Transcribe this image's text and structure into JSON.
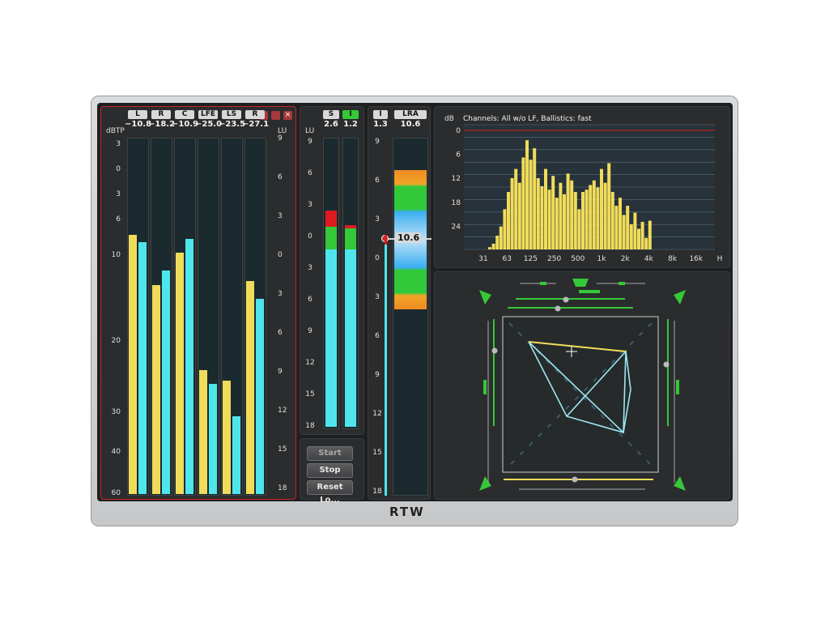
{
  "brand": {
    "logo": "RTW"
  },
  "peak_meter": {
    "scale_left_title": "dBTP",
    "scale_right_title": "LU",
    "channels": [
      {
        "name": "L",
        "value": "−10.8",
        "peak_level": 0.73,
        "rms_level": 0.71
      },
      {
        "name": "R",
        "value": "−18.2",
        "peak_level": 0.59,
        "rms_level": 0.63
      },
      {
        "name": "C",
        "value": "−10.9",
        "peak_level": 0.68,
        "rms_level": 0.72
      },
      {
        "name": "LFE",
        "value": "−25.0",
        "peak_level": 0.35,
        "rms_level": 0.31
      },
      {
        "name": "LS",
        "value": "−23.5",
        "peak_level": 0.32,
        "rms_level": 0.22
      },
      {
        "name": "R",
        "value": "−27.1",
        "peak_level": 0.6,
        "rms_level": 0.55
      }
    ],
    "left_scale": [
      "3",
      "0",
      "3",
      "6",
      "10",
      "20",
      "30",
      "40",
      "60"
    ],
    "right_scale": [
      "9",
      "6",
      "3",
      "0",
      "3",
      "6",
      "9",
      "12",
      "15",
      "18"
    ]
  },
  "loudness": {
    "scale_title": "LU",
    "meters": [
      {
        "name": "S",
        "value": "2.6",
        "active": false
      },
      {
        "name": "I",
        "value": "1.2",
        "active": true
      }
    ],
    "scale": [
      "9",
      "6",
      "3",
      "0",
      "3",
      "6",
      "9",
      "12",
      "15",
      "18"
    ],
    "buttons": {
      "start": "Start",
      "stop": "Stop",
      "reset": "Reset Lo..."
    }
  },
  "lra": {
    "meters": [
      {
        "name": "I",
        "value": "1.3"
      },
      {
        "name": "LRA",
        "value": "10.6"
      }
    ],
    "scale": [
      "9",
      "6",
      "3",
      "0",
      "3",
      "6",
      "9",
      "12",
      "15",
      "18"
    ],
    "marker_value": "10.6"
  },
  "rta": {
    "unit": "dB",
    "title": "Channels: All w/o LF, Ballistics: fast",
    "y_ticks": [
      "0",
      "6",
      "12",
      "18",
      "24"
    ],
    "x_ticks": [
      "31",
      "63",
      "125",
      "250",
      "500",
      "1k",
      "2k",
      "4k",
      "8k",
      "16k",
      "H"
    ],
    "bars": [
      0.02,
      0.05,
      0.12,
      0.2,
      0.35,
      0.5,
      0.62,
      0.7,
      0.58,
      0.8,
      0.95,
      0.78,
      0.88,
      0.62,
      0.55,
      0.7,
      0.52,
      0.64,
      0.45,
      0.58,
      0.48,
      0.66,
      0.6,
      0.5,
      0.35,
      0.5,
      0.52,
      0.56,
      0.6,
      0.54,
      0.7,
      0.58,
      0.75,
      0.5,
      0.38,
      0.45,
      0.3,
      0.38,
      0.22,
      0.32,
      0.18,
      0.24,
      0.1,
      0.25
    ]
  },
  "colors": {
    "accent_green": "#35c838",
    "peak_yellow": "#f1dc5a",
    "rms_cyan": "#4ee6ec",
    "alert_red": "#e0191f"
  }
}
